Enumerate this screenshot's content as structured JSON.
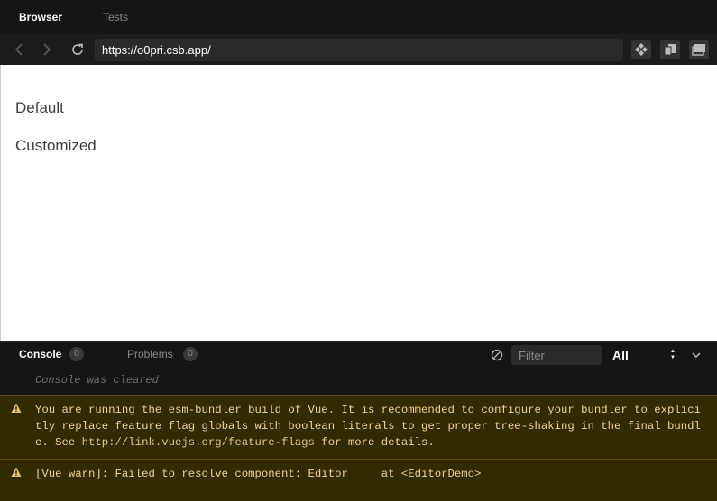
{
  "tabs": {
    "browser": "Browser",
    "tests": "Tests"
  },
  "navbar": {
    "url": "https://o0pri.csb.app/"
  },
  "viewport": {
    "heading_default": "Default",
    "heading_customized": "Customized"
  },
  "console": {
    "tab_console": "Console",
    "console_count": "0",
    "tab_problems": "Problems",
    "problems_count": "0",
    "filter_placeholder": "Filter",
    "level": "All",
    "cleared_message": "Console was cleared",
    "warnings": [
      {
        "text_before_link": "You are running the esm-bundler build of Vue. It is recommended to configure your bundler to explicitly replace feature flag globals with boolean literals to get proper tree-shaking in the final bundle. See ",
        "link": "http://link.vuejs.org/feature-flags",
        "text_after_link": " for more details."
      },
      {
        "text": "[Vue warn]: Failed to resolve component: Editor     at <EditorDemo>"
      }
    ]
  },
  "colors": {
    "chrome_bg": "#151515",
    "url_bg": "#2a2a2a",
    "warn_bg": "#332b00",
    "warn_text": "#f2d29a",
    "warn_icon": "#e8c27a"
  },
  "icons": {
    "back": "chevron-left-icon",
    "forward": "chevron-right-icon",
    "reload": "reload-icon",
    "devtools": "diamond-icon",
    "new_window": "copy-icon",
    "fullscreen": "window-icon",
    "clear": "clear-circle-icon",
    "collapse": "chevron-down-icon",
    "warning": "warning-triangle-icon"
  }
}
